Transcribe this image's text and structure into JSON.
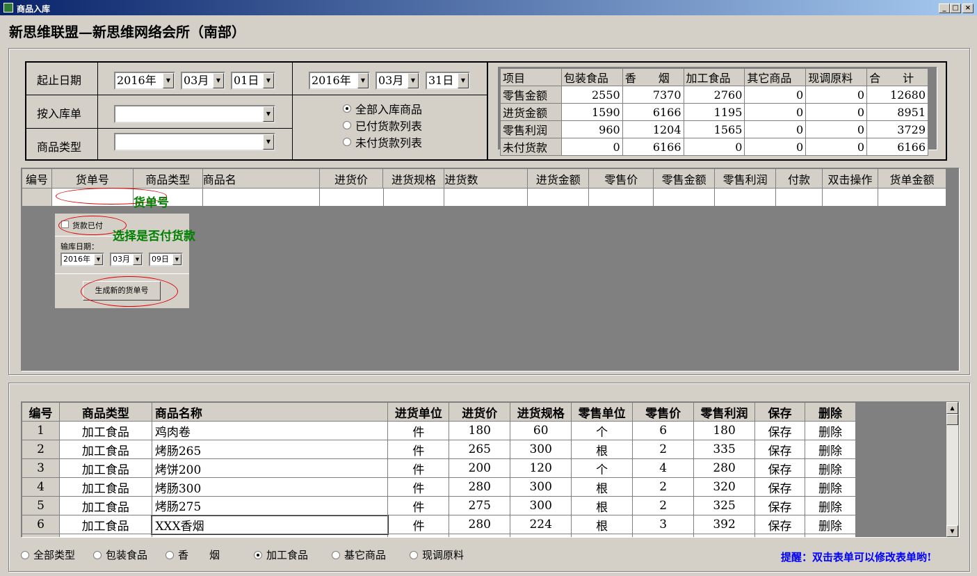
{
  "window": {
    "title": "商品入库",
    "min": "_",
    "max": "□",
    "close": "×"
  },
  "app_title": "新思维联盟—新思维网络会所（南部）",
  "filters": {
    "date_label": "起止日期",
    "order_label": "按入库单",
    "type_label": "商品类型",
    "start": {
      "year": "2016年",
      "month": "03月",
      "day": "01日"
    },
    "end": {
      "year": "2016年",
      "month": "03月",
      "day": "31日"
    },
    "order_value": "",
    "type_value": "",
    "radios": [
      {
        "label": "全部入库商品",
        "checked": true
      },
      {
        "label": "已付货款列表",
        "checked": false
      },
      {
        "label": "未付货款列表",
        "checked": false
      }
    ]
  },
  "summary": {
    "headers": [
      "项目",
      "包装食品",
      "香　　烟",
      "加工食品",
      "其它商品",
      "现调原料",
      "合　　计"
    ],
    "rows": [
      {
        "label": "零售金额",
        "values": [
          "2550",
          "7370",
          "2760",
          "0",
          "0",
          "12680"
        ]
      },
      {
        "label": "进货金额",
        "values": [
          "1590",
          "6166",
          "1195",
          "0",
          "0",
          "8951"
        ]
      },
      {
        "label": "零售利润",
        "values": [
          "960",
          "1204",
          "1565",
          "0",
          "0",
          "3729"
        ]
      },
      {
        "label": "未付货款",
        "values": [
          "0",
          "6166",
          "0",
          "0",
          "0",
          "6166"
        ]
      }
    ]
  },
  "grid": {
    "headers": [
      "编号",
      "货单号",
      "商品类型",
      "商品名",
      "进货价",
      "进货规格",
      "进货数",
      "进货金额",
      "零售价",
      "零售金额",
      "零售利润",
      "付款",
      "双击操作",
      "货单金额"
    ]
  },
  "annotations": {
    "order_no": "货单号",
    "paid": "选择是否付货款"
  },
  "popup": {
    "paid_label": "货款已付",
    "date_label": "输库日期：",
    "year": "2016年",
    "month": "03月",
    "day": "09日",
    "generate_label": "生成新的货单号"
  },
  "products": {
    "headers": [
      "编号",
      "商品类型",
      "商品名称",
      "进货单位",
      "进货价",
      "进货规格",
      "零售单位",
      "零售价",
      "零售利润",
      "保存",
      "删除"
    ],
    "rows": [
      {
        "id": "1",
        "type": "加工食品",
        "name": "鸡肉卷",
        "unit": "件",
        "price": "180",
        "spec": "60",
        "runit": "个",
        "rprice": "6",
        "profit": "180",
        "save": "保存",
        "del": "删除"
      },
      {
        "id": "2",
        "type": "加工食品",
        "name": "烤肠265",
        "unit": "件",
        "price": "265",
        "spec": "300",
        "runit": "根",
        "rprice": "2",
        "profit": "335",
        "save": "保存",
        "del": "删除"
      },
      {
        "id": "3",
        "type": "加工食品",
        "name": "烤饼200",
        "unit": "件",
        "price": "200",
        "spec": "120",
        "runit": "个",
        "rprice": "4",
        "profit": "280",
        "save": "保存",
        "del": "删除"
      },
      {
        "id": "4",
        "type": "加工食品",
        "name": "烤肠300",
        "unit": "件",
        "price": "280",
        "spec": "300",
        "runit": "根",
        "rprice": "2",
        "profit": "320",
        "save": "保存",
        "del": "删除"
      },
      {
        "id": "5",
        "type": "加工食品",
        "name": "烤肠275",
        "unit": "件",
        "price": "275",
        "spec": "300",
        "runit": "根",
        "rprice": "2",
        "profit": "325",
        "save": "保存",
        "del": "删除"
      },
      {
        "id": "6",
        "type": "加工食品",
        "name": "XXX香烟",
        "unit": "件",
        "price": "280",
        "spec": "224",
        "runit": "根",
        "rprice": "3",
        "profit": "392",
        "save": "保存",
        "del": "删除"
      }
    ]
  },
  "type_filter": [
    {
      "label": "全部类型",
      "checked": false
    },
    {
      "label": "包装食品",
      "checked": false
    },
    {
      "label": "香　　烟",
      "checked": false
    },
    {
      "label": "加工食品",
      "checked": true
    },
    {
      "label": "基它商品",
      "checked": false
    },
    {
      "label": "现调原料",
      "checked": false
    }
  ],
  "tip": "提醒：双击表单可以修改表单哟!"
}
